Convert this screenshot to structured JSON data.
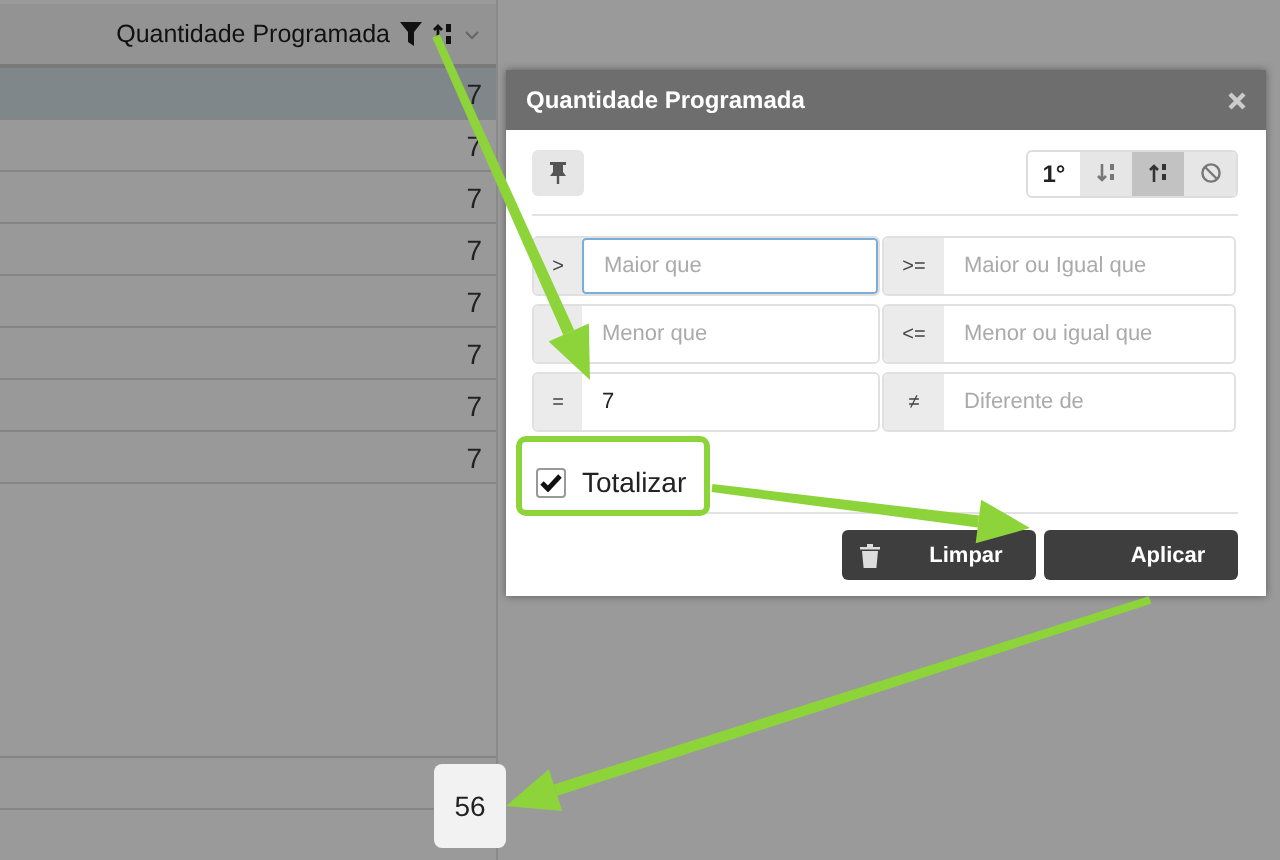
{
  "grid": {
    "column": {
      "title": "Quantidade Programada",
      "filtered": true
    },
    "rows": [
      {
        "value": "7",
        "selected": true
      },
      {
        "value": "7",
        "selected": false
      },
      {
        "value": "7",
        "selected": false
      },
      {
        "value": "7",
        "selected": false
      },
      {
        "value": "7",
        "selected": false
      },
      {
        "value": "7",
        "selected": false
      },
      {
        "value": "7",
        "selected": false
      },
      {
        "value": "7",
        "selected": false
      }
    ],
    "total": "56"
  },
  "dialog": {
    "title": "Quantidade Programada",
    "sort": {
      "order": "1°",
      "options": [
        {
          "kind": "asc",
          "selected": false
        },
        {
          "kind": "desc",
          "selected": true
        },
        {
          "kind": "none",
          "selected": false
        }
      ]
    },
    "filters": [
      {
        "operator": ">",
        "placeholder": "Maior que",
        "focused": true
      },
      {
        "operator": ">=",
        "placeholder": "Maior ou Igual que",
        "focused": false
      },
      {
        "placeholder": "Menor que",
        "focused": false
      },
      {
        "operator": "<=",
        "placeholder": "Menor ou igual que",
        "focused": false
      },
      {
        "operator": "=",
        "value": "7",
        "focused": false
      },
      {
        "operator": "≠",
        "placeholder": "Diferente de",
        "focused": false
      }
    ],
    "totalize": {
      "label": "Totalizar",
      "checked": true
    },
    "buttons": [
      {
        "label": "Limpar",
        "kind": "clear"
      },
      {
        "label": "Aplicar",
        "kind": "apply"
      }
    ]
  }
}
